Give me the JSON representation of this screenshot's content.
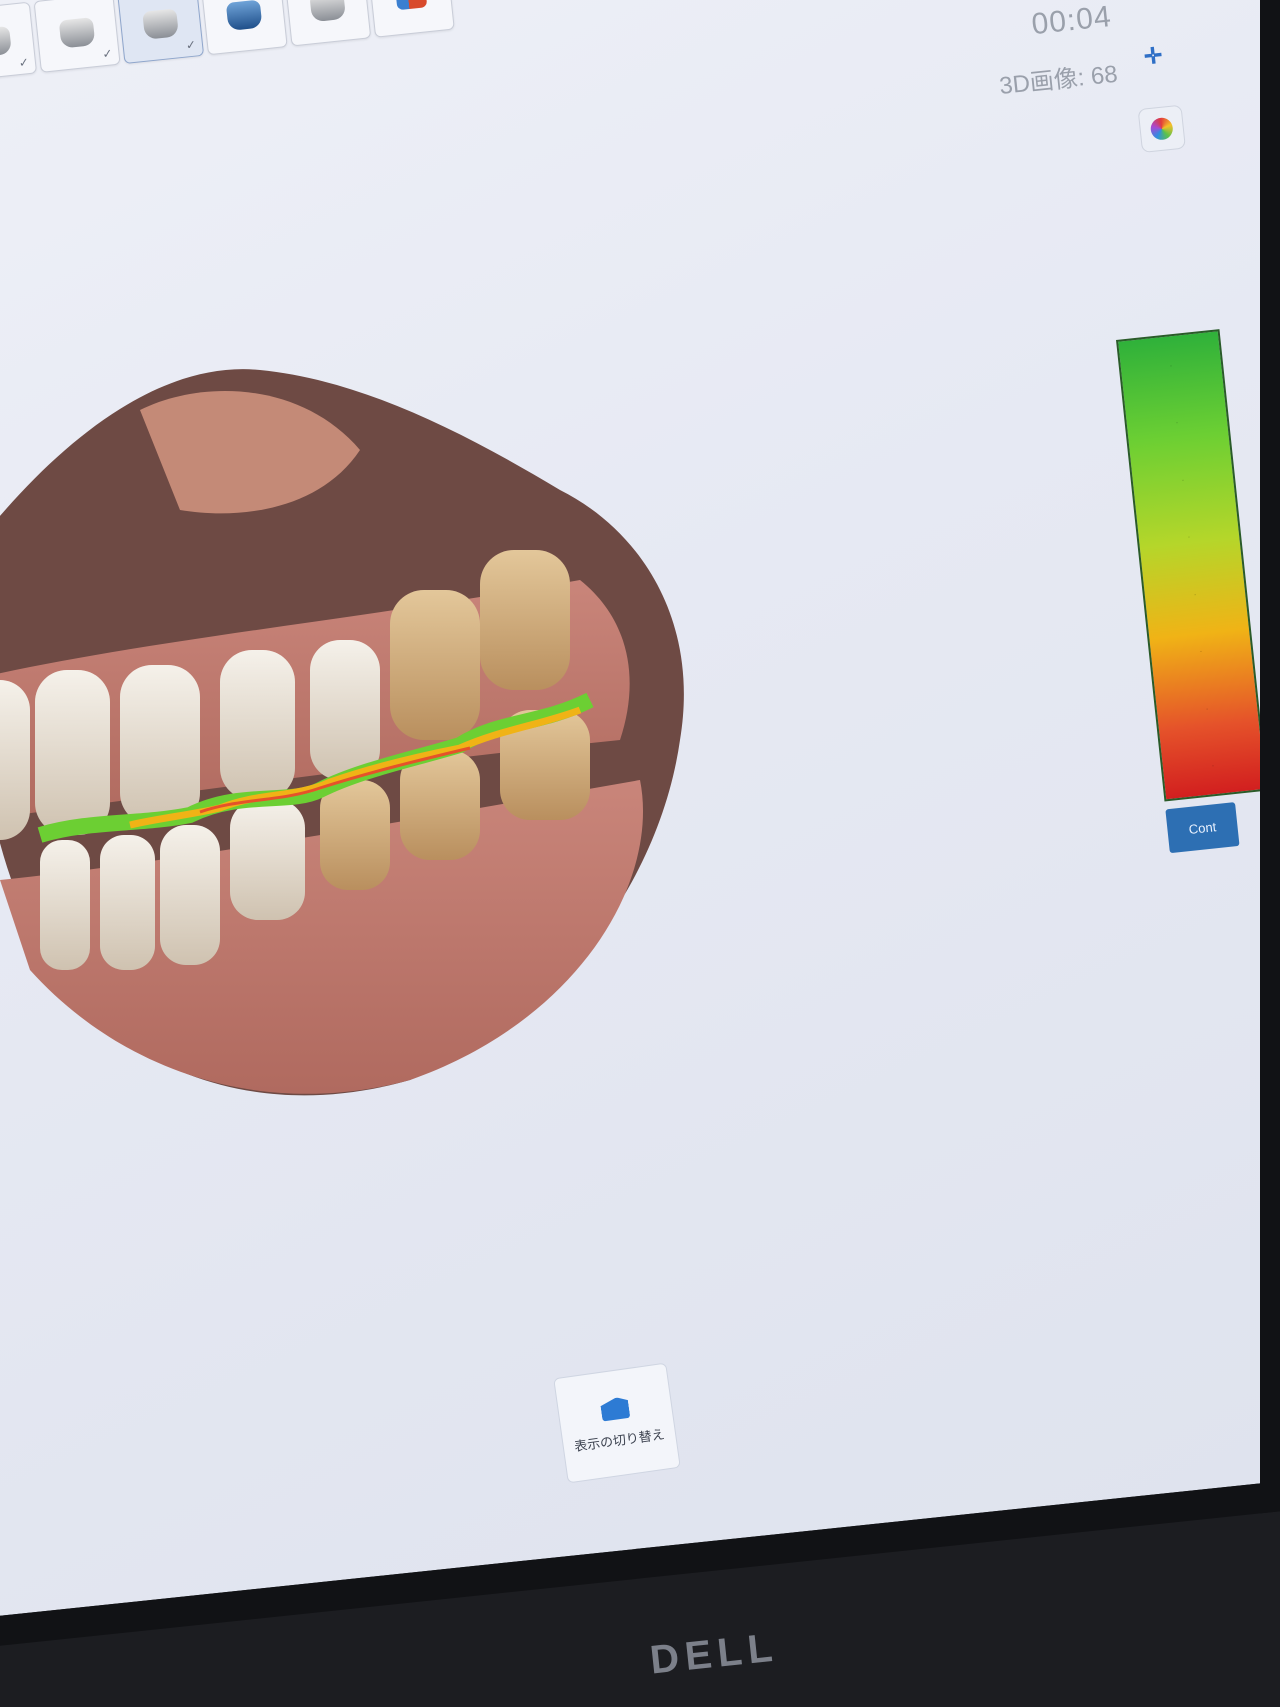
{
  "toolbar": {
    "steps": [
      {
        "icon": "lower-jaw-icon",
        "state": "done"
      },
      {
        "icon": "upper-jaw-icon",
        "state": "done"
      },
      {
        "icon": "jaw-scan-icon",
        "state": "active"
      },
      {
        "icon": "bite-scan-icon",
        "state": "todo"
      },
      {
        "icon": "crown-icon",
        "state": "todo"
      },
      {
        "icon": "bite-align-icon",
        "state": "todo"
      }
    ]
  },
  "status": {
    "timer": "00:04",
    "count_label": "3D画像: 68"
  },
  "right_tools": {
    "add_icon": "plus-icon",
    "color_icon": "color-wheel-icon"
  },
  "legend": {
    "button_label": "Cont"
  },
  "bottom_button": {
    "label": "表示の切り替え"
  },
  "monitor": {
    "brand": "DELL"
  },
  "colors": {
    "accent": "#2d6fb3",
    "scale_top": "#2fb13a",
    "scale_mid": "#f0b316",
    "scale_bottom": "#d21f1f"
  }
}
